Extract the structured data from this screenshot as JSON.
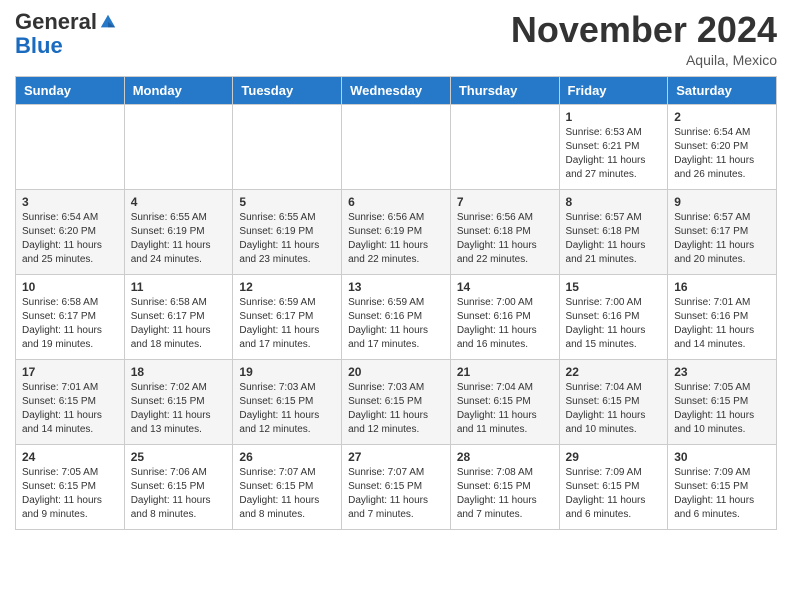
{
  "header": {
    "logo_general": "General",
    "logo_blue": "Blue",
    "month_title": "November 2024",
    "location": "Aquila, Mexico"
  },
  "weekdays": [
    "Sunday",
    "Monday",
    "Tuesday",
    "Wednesday",
    "Thursday",
    "Friday",
    "Saturday"
  ],
  "weeks": [
    [
      {
        "day": "",
        "info": ""
      },
      {
        "day": "",
        "info": ""
      },
      {
        "day": "",
        "info": ""
      },
      {
        "day": "",
        "info": ""
      },
      {
        "day": "",
        "info": ""
      },
      {
        "day": "1",
        "info": "Sunrise: 6:53 AM\nSunset: 6:21 PM\nDaylight: 11 hours and 27 minutes."
      },
      {
        "day": "2",
        "info": "Sunrise: 6:54 AM\nSunset: 6:20 PM\nDaylight: 11 hours and 26 minutes."
      }
    ],
    [
      {
        "day": "3",
        "info": "Sunrise: 6:54 AM\nSunset: 6:20 PM\nDaylight: 11 hours and 25 minutes."
      },
      {
        "day": "4",
        "info": "Sunrise: 6:55 AM\nSunset: 6:19 PM\nDaylight: 11 hours and 24 minutes."
      },
      {
        "day": "5",
        "info": "Sunrise: 6:55 AM\nSunset: 6:19 PM\nDaylight: 11 hours and 23 minutes."
      },
      {
        "day": "6",
        "info": "Sunrise: 6:56 AM\nSunset: 6:19 PM\nDaylight: 11 hours and 22 minutes."
      },
      {
        "day": "7",
        "info": "Sunrise: 6:56 AM\nSunset: 6:18 PM\nDaylight: 11 hours and 22 minutes."
      },
      {
        "day": "8",
        "info": "Sunrise: 6:57 AM\nSunset: 6:18 PM\nDaylight: 11 hours and 21 minutes."
      },
      {
        "day": "9",
        "info": "Sunrise: 6:57 AM\nSunset: 6:17 PM\nDaylight: 11 hours and 20 minutes."
      }
    ],
    [
      {
        "day": "10",
        "info": "Sunrise: 6:58 AM\nSunset: 6:17 PM\nDaylight: 11 hours and 19 minutes."
      },
      {
        "day": "11",
        "info": "Sunrise: 6:58 AM\nSunset: 6:17 PM\nDaylight: 11 hours and 18 minutes."
      },
      {
        "day": "12",
        "info": "Sunrise: 6:59 AM\nSunset: 6:17 PM\nDaylight: 11 hours and 17 minutes."
      },
      {
        "day": "13",
        "info": "Sunrise: 6:59 AM\nSunset: 6:16 PM\nDaylight: 11 hours and 17 minutes."
      },
      {
        "day": "14",
        "info": "Sunrise: 7:00 AM\nSunset: 6:16 PM\nDaylight: 11 hours and 16 minutes."
      },
      {
        "day": "15",
        "info": "Sunrise: 7:00 AM\nSunset: 6:16 PM\nDaylight: 11 hours and 15 minutes."
      },
      {
        "day": "16",
        "info": "Sunrise: 7:01 AM\nSunset: 6:16 PM\nDaylight: 11 hours and 14 minutes."
      }
    ],
    [
      {
        "day": "17",
        "info": "Sunrise: 7:01 AM\nSunset: 6:15 PM\nDaylight: 11 hours and 14 minutes."
      },
      {
        "day": "18",
        "info": "Sunrise: 7:02 AM\nSunset: 6:15 PM\nDaylight: 11 hours and 13 minutes."
      },
      {
        "day": "19",
        "info": "Sunrise: 7:03 AM\nSunset: 6:15 PM\nDaylight: 11 hours and 12 minutes."
      },
      {
        "day": "20",
        "info": "Sunrise: 7:03 AM\nSunset: 6:15 PM\nDaylight: 11 hours and 12 minutes."
      },
      {
        "day": "21",
        "info": "Sunrise: 7:04 AM\nSunset: 6:15 PM\nDaylight: 11 hours and 11 minutes."
      },
      {
        "day": "22",
        "info": "Sunrise: 7:04 AM\nSunset: 6:15 PM\nDaylight: 11 hours and 10 minutes."
      },
      {
        "day": "23",
        "info": "Sunrise: 7:05 AM\nSunset: 6:15 PM\nDaylight: 11 hours and 10 minutes."
      }
    ],
    [
      {
        "day": "24",
        "info": "Sunrise: 7:05 AM\nSunset: 6:15 PM\nDaylight: 11 hours and 9 minutes."
      },
      {
        "day": "25",
        "info": "Sunrise: 7:06 AM\nSunset: 6:15 PM\nDaylight: 11 hours and 8 minutes."
      },
      {
        "day": "26",
        "info": "Sunrise: 7:07 AM\nSunset: 6:15 PM\nDaylight: 11 hours and 8 minutes."
      },
      {
        "day": "27",
        "info": "Sunrise: 7:07 AM\nSunset: 6:15 PM\nDaylight: 11 hours and 7 minutes."
      },
      {
        "day": "28",
        "info": "Sunrise: 7:08 AM\nSunset: 6:15 PM\nDaylight: 11 hours and 7 minutes."
      },
      {
        "day": "29",
        "info": "Sunrise: 7:09 AM\nSunset: 6:15 PM\nDaylight: 11 hours and 6 minutes."
      },
      {
        "day": "30",
        "info": "Sunrise: 7:09 AM\nSunset: 6:15 PM\nDaylight: 11 hours and 6 minutes."
      }
    ]
  ]
}
